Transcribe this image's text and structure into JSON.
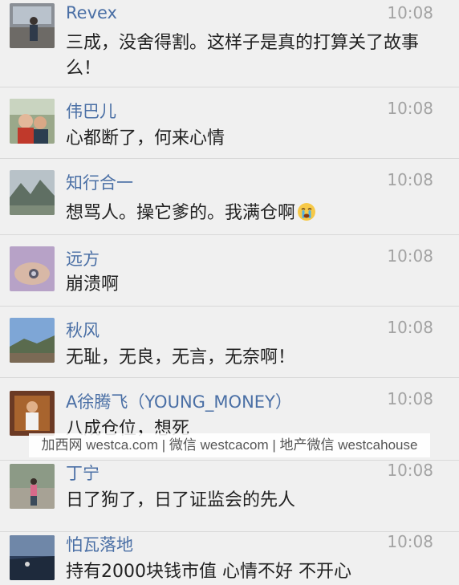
{
  "comments": [
    {
      "name": "Revex",
      "time": "10:08",
      "text": "三成，没舍得割。这样子是真的打算关了故事么！"
    },
    {
      "name": "伟巴儿",
      "time": "10:08",
      "text": "心都断了，何来心情"
    },
    {
      "name": "知行合一",
      "time": "10:08",
      "text": "想骂人。操它爹的。我满仓啊"
    },
    {
      "name": "远方",
      "time": "10:08",
      "text": "崩溃啊"
    },
    {
      "name": "秋风",
      "time": "10:08",
      "text": "无耻，无良，无言，无奈啊！"
    },
    {
      "name": "A徐腾飞（YOUNG_MONEY）",
      "time": "10:08",
      "text": "八成仓位，想死"
    },
    {
      "name": "丁宁",
      "time": "10:08",
      "text": "日了狗了，日了证监会的先人"
    },
    {
      "name": "怕瓦落地",
      "time": "10:08",
      "text": "持有2000块钱市值 心情不好 不开心"
    }
  ],
  "emoji": "crying-face",
  "watermark": "加西网 westca.com | 微信 westcacom | 地产微信 westcahouse",
  "colors": {
    "name": "#4a6fa5",
    "time": "#a3a3a3",
    "text": "#222222",
    "background": "#f0f0f0"
  }
}
